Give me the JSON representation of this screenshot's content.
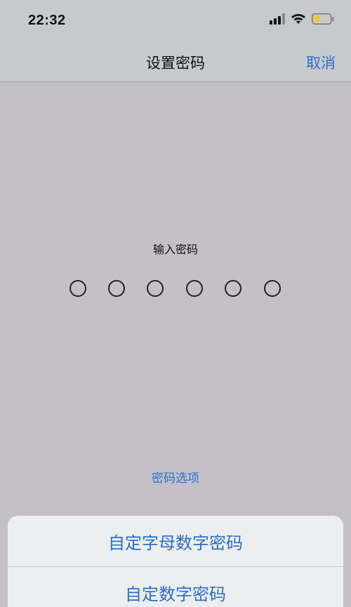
{
  "status_bar": {
    "time": "22:32",
    "icons": [
      "cellular-signal-icon",
      "wifi-icon",
      "battery-low-icon"
    ],
    "battery_color": "#f2c53d"
  },
  "nav": {
    "title": "设置密码",
    "cancel_label": "取消"
  },
  "passcode": {
    "prompt": "输入密码",
    "digit_count": 6,
    "entered_count": 0
  },
  "options_link": "密码选项",
  "action_sheet": {
    "items": [
      {
        "label": "自定字母数字密码"
      },
      {
        "label": "自定数字密码"
      }
    ]
  },
  "colors": {
    "accent": "#2b6fd1",
    "background": "#c3c0c7",
    "top_bar": "#c8c9cb",
    "sheet": "#eceef0"
  }
}
